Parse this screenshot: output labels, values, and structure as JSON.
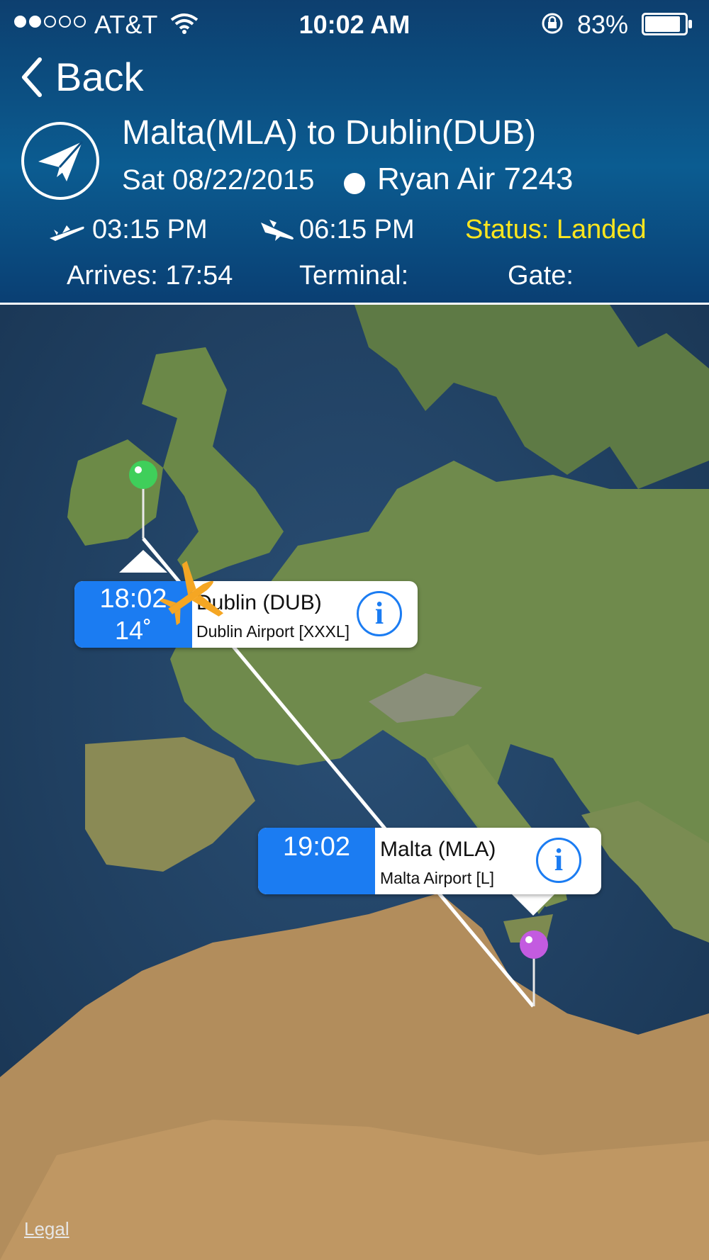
{
  "status_bar": {
    "carrier": "AT&T",
    "time": "10:02 AM",
    "battery": "83%",
    "signal_bars_filled": 2,
    "signal_bars_total": 5
  },
  "nav": {
    "back_label": "Back"
  },
  "flight": {
    "route": "Malta(MLA) to Dublin(DUB)",
    "date": "Sat 08/22/2015",
    "airline": "Ryan Air 7243",
    "departure_time": "03:15 PM",
    "arrival_time": "06:15 PM",
    "status": "Status: Landed",
    "arrives": "Arrives: 17:54",
    "terminal": "Terminal:",
    "gate": "Gate:"
  },
  "map": {
    "destination_callout": {
      "time": "18:02",
      "temperature": "14˚",
      "name": "Dublin (DUB)",
      "airport": "Dublin Airport [XXXL]"
    },
    "origin_callout": {
      "time": "19:02",
      "name": "Malta (MLA)",
      "airport": "Malta Airport [L]"
    },
    "legal_label": "Legal"
  },
  "colors": {
    "status": "#ffe61e",
    "callout_blue": "#1b7cf2",
    "plane_marker": "#f5a623",
    "destination_pin": "#3fcf5a",
    "origin_pin": "#c35be0"
  },
  "icons": {
    "badge": "paper-plane-icon",
    "departure": "plane-takeoff-icon",
    "arrival": "plane-landing-icon",
    "info": "info-icon"
  }
}
